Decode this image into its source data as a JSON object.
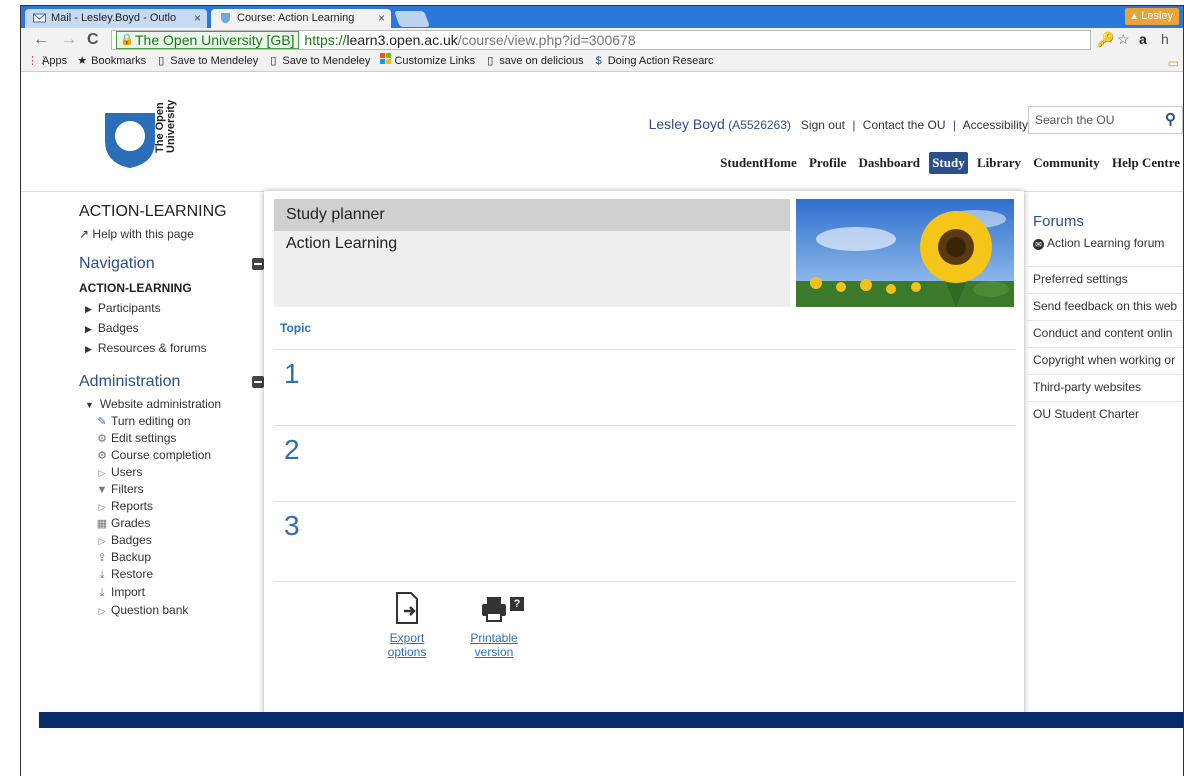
{
  "browser": {
    "tabs": [
      {
        "title": "Mail - Lesley.Boyd - Outlo",
        "close": "×"
      },
      {
        "title": "Course: Action Learning",
        "close": "×"
      }
    ],
    "profile_name": "Lesley",
    "ev_name": "The Open University [GB]",
    "url_scheme": "https://",
    "url_host": "learn3.open.ac.uk",
    "url_path": "/course/view.php?id=300678",
    "bookmarks": [
      "Apps",
      "Bookmarks",
      "Save to Mendeley",
      "Save to Mendeley",
      "Customize Links",
      "save on delicious",
      "Doing Action Researc"
    ]
  },
  "header": {
    "logo_line1": "The Open",
    "logo_line2": "University",
    "user_name": "Lesley Boyd",
    "user_id": "(A5526263)",
    "links": [
      "Sign out",
      "Contact the OU",
      "Accessibility"
    ],
    "search_placeholder": "Search the OU",
    "nav": [
      "StudentHome",
      "Profile",
      "Dashboard",
      "Study",
      "Library",
      "Community",
      "Help Centre"
    ],
    "active_nav": "Study"
  },
  "left": {
    "course_code": "ACTION-LEARNING",
    "help_link": "Help with this page",
    "navigation_title": "Navigation",
    "navigation_head": "ACTION-LEARNING",
    "navigation_items": [
      "Participants",
      "Badges",
      "Resources & forums"
    ],
    "admin_title": "Administration",
    "admin_root": "Website administration",
    "admin_items": [
      "Turn editing on",
      "Edit settings",
      "Course completion",
      "Users",
      "Filters",
      "Reports",
      "Grades",
      "Badges",
      "Backup",
      "Restore",
      "Import",
      "Question bank"
    ]
  },
  "main": {
    "planner_title": "Study planner",
    "course_name": "Action Learning",
    "topic_label": "Topic",
    "topics": [
      "1",
      "2",
      "3"
    ],
    "export_line1": "Export",
    "export_line2": "options",
    "print_line1": "Printable",
    "print_line2": "version",
    "help_badge": "?"
  },
  "right": {
    "forums_title": "Forums",
    "forum_link": "Action Learning forum",
    "links": [
      "Preferred settings",
      "Send feedback on this web",
      "Conduct and content onlin",
      "Copyright when working or",
      "Third-party websites",
      "OU Student Charter"
    ]
  },
  "colors": {
    "ou_blue": "#2a4f8a",
    "link_blue": "#2a6fb8",
    "tab_strip": "#2a79d9",
    "footer_navy": "#0a2a6a"
  }
}
